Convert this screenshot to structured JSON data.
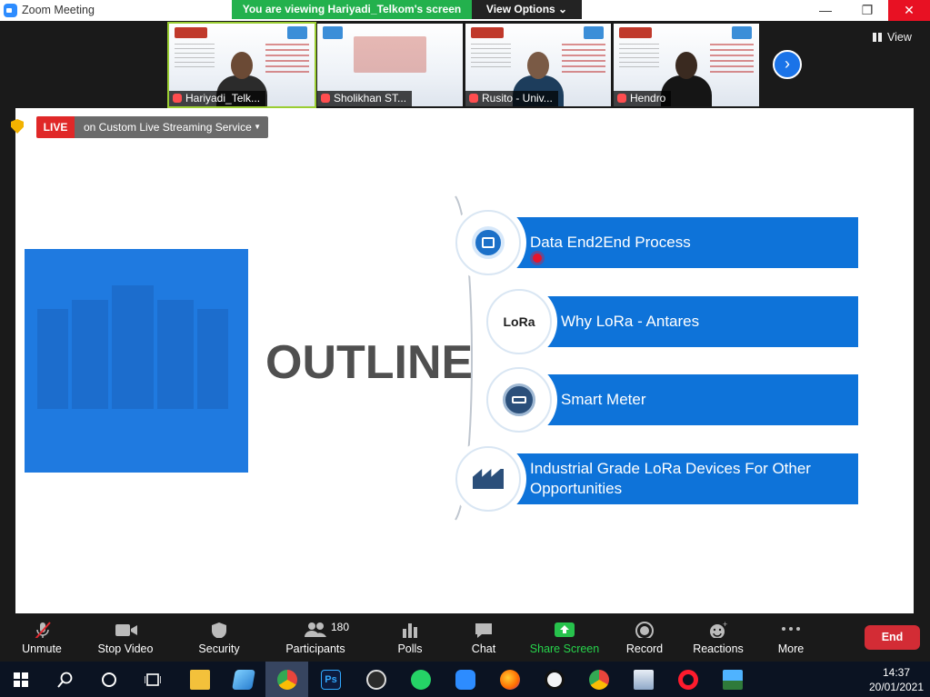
{
  "window": {
    "title": "Zoom Meeting",
    "min": "—",
    "max": "❐",
    "close": "✕"
  },
  "banner": {
    "viewing": "You are viewing Hariyadi_Telkom's screen",
    "view_options": "View Options ⌄"
  },
  "participants_strip": [
    {
      "name": "Hariyadi_Telk...",
      "muted": true
    },
    {
      "name": "Sholikhan ST...",
      "muted": true
    },
    {
      "name": "Rusito - Univ...",
      "muted": true
    },
    {
      "name": "Hendro",
      "muted": true
    }
  ],
  "view_button": "View",
  "live": {
    "badge": "LIVE",
    "service": "on Custom Live Streaming Service",
    "caret": "▼"
  },
  "slide": {
    "title": "OUTLINE",
    "items": [
      {
        "label": "Data End2End Process",
        "icon": "data-process-icon"
      },
      {
        "label": "Why LoRa - Antares",
        "icon": "lora-logo-icon",
        "icon_text": "LoRa"
      },
      {
        "label": "Smart Meter",
        "icon": "smart-meter-icon"
      },
      {
        "label": "Industrial Grade LoRa Devices For Other Opportunities",
        "icon": "factory-icon"
      }
    ],
    "accent": "#0e73d9"
  },
  "toolbar": {
    "unmute": "Unmute",
    "stop_video": "Stop Video",
    "security": "Security",
    "participants": "Participants",
    "participants_count": "180",
    "polls": "Polls",
    "chat": "Chat",
    "share_screen": "Share Screen",
    "record": "Record",
    "reactions": "Reactions",
    "more": "More",
    "end": "End"
  },
  "taskbar": {
    "time": "14:37",
    "date": "20/01/2021"
  }
}
